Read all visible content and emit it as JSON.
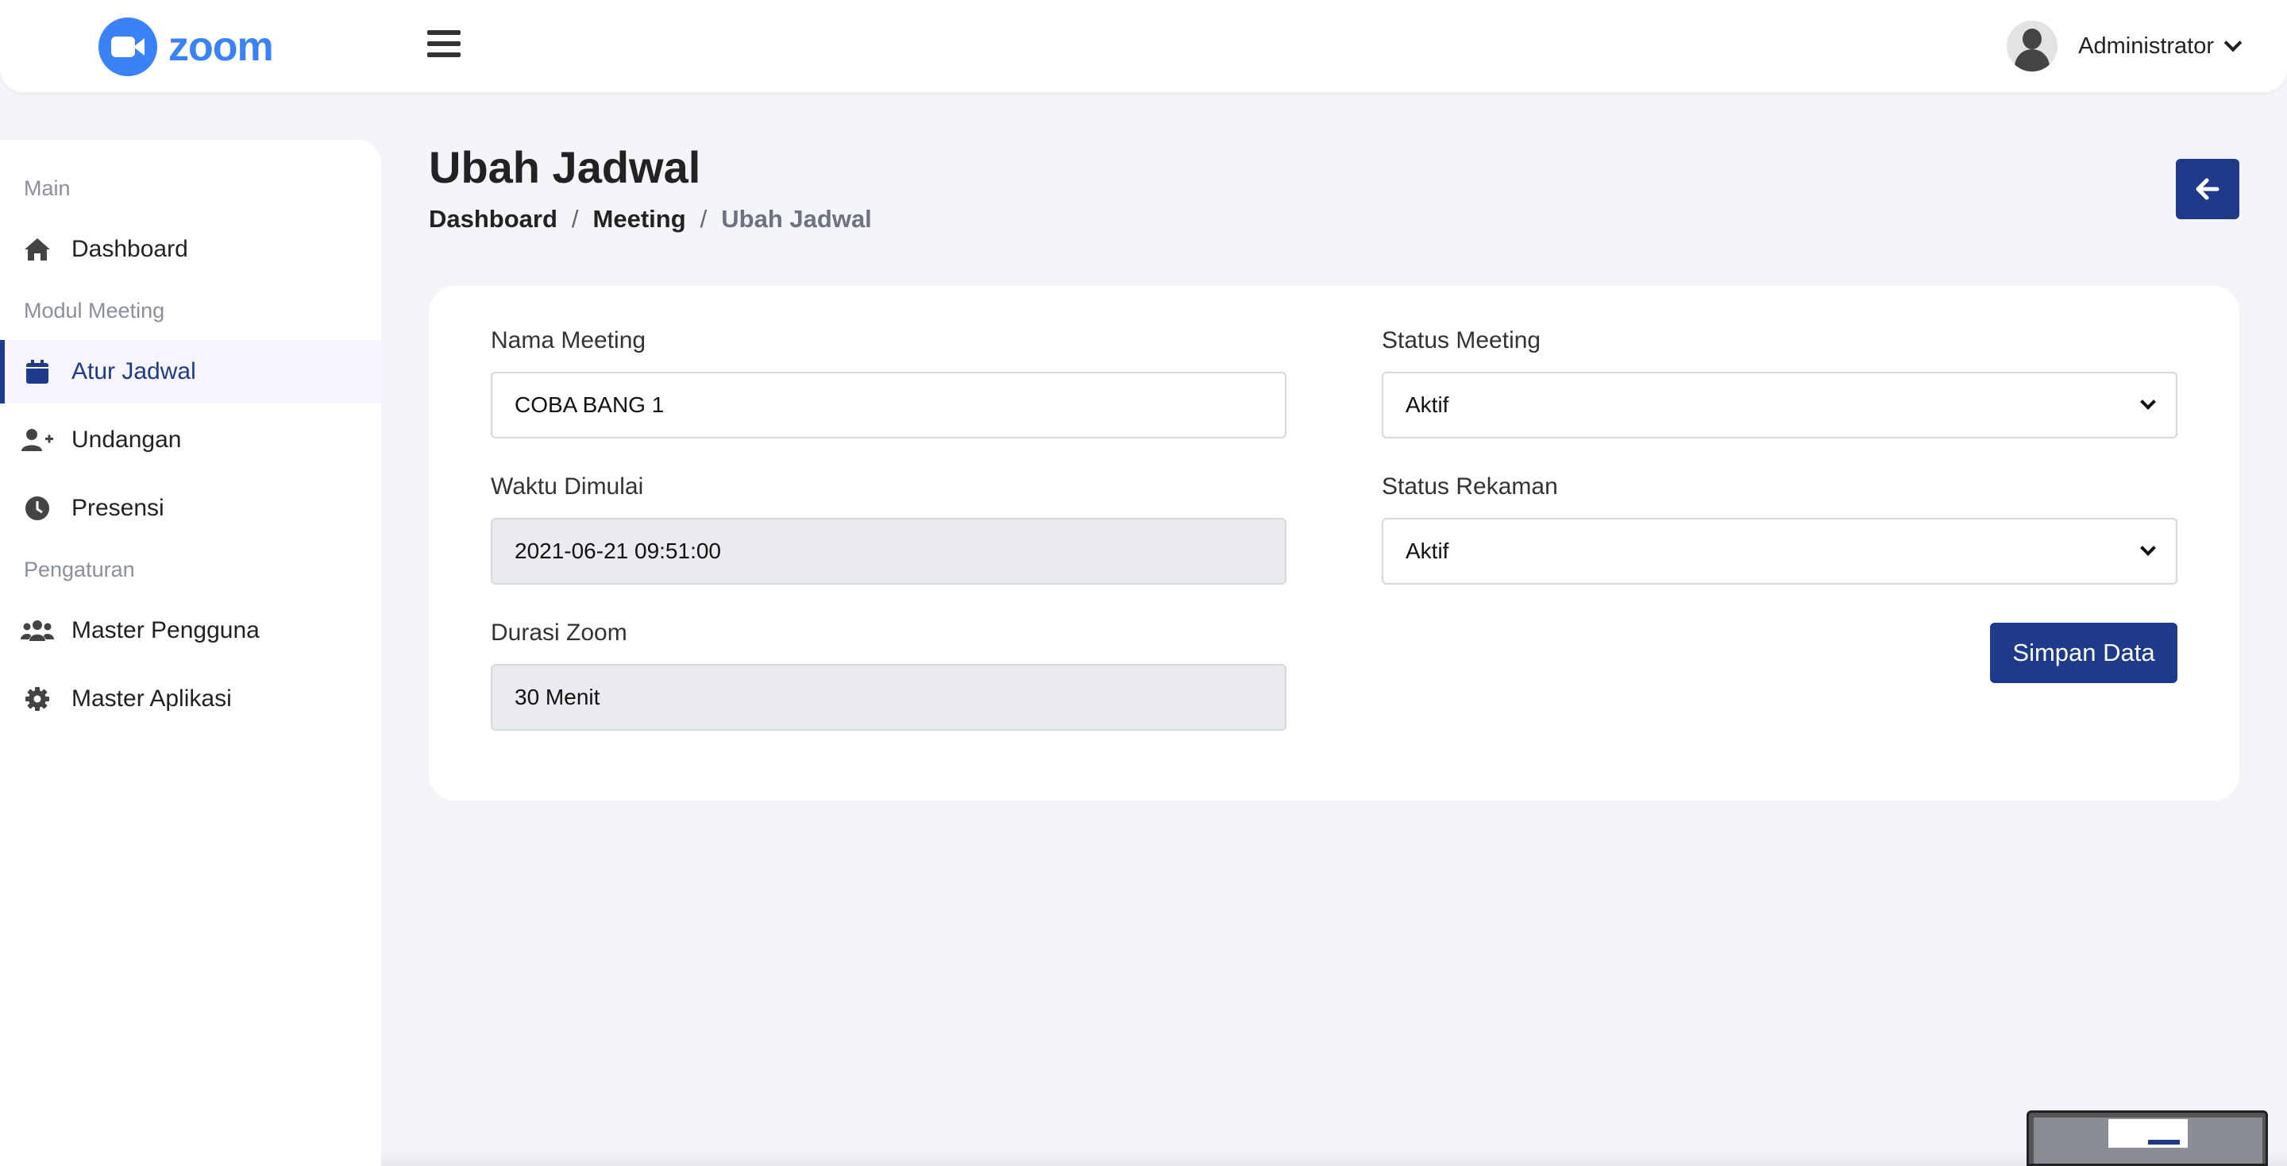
{
  "brand": {
    "logo_text": "zoom",
    "accent": "#3b82f6"
  },
  "header": {
    "user_name": "Administrator"
  },
  "sidebar": {
    "sections": {
      "main": "Main",
      "meeting": "Modul Meeting",
      "settings": "Pengaturan"
    },
    "items": [
      {
        "label": "Dashboard",
        "icon": "home-icon"
      },
      {
        "label": "Atur Jadwal",
        "icon": "calendar-icon",
        "active": true
      },
      {
        "label": "Undangan",
        "icon": "user-plus-icon"
      },
      {
        "label": "Presensi",
        "icon": "clock-icon"
      },
      {
        "label": "Master Pengguna",
        "icon": "users-icon"
      },
      {
        "label": "Master Aplikasi",
        "icon": "gear-icon"
      }
    ]
  },
  "page": {
    "title": "Ubah Jadwal",
    "breadcrumb": [
      "Dashboard",
      "Meeting",
      "Ubah Jadwal"
    ],
    "breadcrumb_sep": "/"
  },
  "form": {
    "nama_meeting": {
      "label": "Nama Meeting",
      "value": "COBA BANG 1"
    },
    "waktu_dimulai": {
      "label": "Waktu Dimulai",
      "value": "2021-06-21 09:51:00"
    },
    "durasi_zoom": {
      "label": "Durasi Zoom",
      "value": "30 Menit"
    },
    "status_meeting": {
      "label": "Status Meeting",
      "value": "Aktif"
    },
    "status_rekaman": {
      "label": "Status Rekaman",
      "value": "Aktif"
    },
    "save_label": "Simpan Data"
  },
  "colors": {
    "primary": "#1e3a8a",
    "active_bg": "#f7f4fd",
    "muted": "#8a8f98"
  }
}
